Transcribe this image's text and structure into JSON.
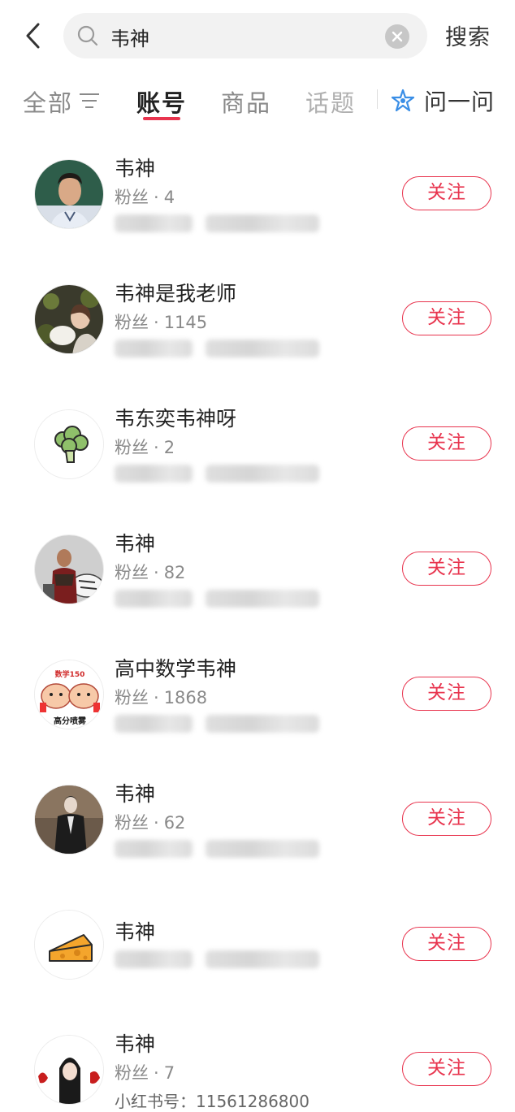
{
  "search": {
    "query": "韦神",
    "submit_label": "搜索"
  },
  "tabs": {
    "all": "全部",
    "accounts": "账号",
    "products": "商品",
    "topics": "话题",
    "ask": "问一问",
    "active": "accounts"
  },
  "colors": {
    "accent": "#e8344e",
    "ask_icon": "#3a8ee6"
  },
  "results": [
    {
      "name": "韦神",
      "fans_label": "粉丝",
      "fans": "4",
      "follow_label": "关注",
      "avatar": "man-portrait-avatar"
    },
    {
      "name": "韦神是我老师",
      "fans_label": "粉丝",
      "fans": "1145",
      "follow_label": "关注",
      "avatar": "woman-with-dog-avatar"
    },
    {
      "name": "韦东奕韦神呀",
      "fans_label": "粉丝",
      "fans": "2",
      "follow_label": "关注",
      "avatar": "broccoli-avatar"
    },
    {
      "name": "韦神",
      "fans_label": "粉丝",
      "fans": "82",
      "follow_label": "关注",
      "avatar": "warrior-tiger-avatar"
    },
    {
      "name": "高中数学韦神",
      "fans_label": "粉丝",
      "fans": "1868",
      "follow_label": "关注",
      "avatar": "math150-cartoon-avatar"
    },
    {
      "name": "韦神",
      "fans_label": "粉丝",
      "fans": "62",
      "follow_label": "关注",
      "avatar": "dark-figure-avatar"
    },
    {
      "name": "韦神",
      "fans_label": "",
      "fans": "",
      "follow_label": "关注",
      "avatar": "cheese-avatar"
    },
    {
      "name": "韦神",
      "fans_label": "粉丝",
      "fans": "7",
      "follow_label": "关注",
      "avatar": "anime-girl-avatar"
    }
  ],
  "avatar_texts": {
    "math_top": "数学150",
    "math_bottom": "高分喷雾"
  },
  "last_row_id_line": "小红书号：11561286800"
}
